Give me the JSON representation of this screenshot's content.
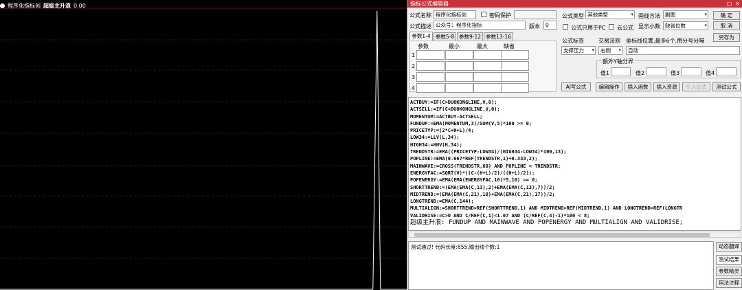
{
  "chart": {
    "indicator_name": "程序化指标创",
    "signal_label": "超级主升浪",
    "signal_value": "0.00",
    "colors": {
      "background": "#000000",
      "line": "#ffffff",
      "grid": "#6b0f12"
    },
    "spike": {
      "baseline": 0.0,
      "peak": 1.0,
      "position": 0.927
    }
  },
  "editor": {
    "title": "指标公式编辑器",
    "name_label": "公式名称",
    "name_value": "程序化指标创",
    "password_label": "密码保护",
    "desc_label": "公式描述",
    "desc_value": "公众号：程序化指标",
    "version_label": "版本",
    "version_value": "0",
    "type_label": "公式类型",
    "type_value": "其他类型",
    "draw_label": "画线方法",
    "draw_value": "副图",
    "confirm_button": "确 定",
    "cancel_button": "取 消",
    "saveas_button": "另存为",
    "pc_only_label": "公式只用于PC",
    "cloud_label": "云公式",
    "decimals_label": "显示小数",
    "decimals_value": "缺省位数",
    "tabs": [
      "参数1-4",
      "参数5-8",
      "参数9-12",
      "参数13-16"
    ],
    "param_headers": [
      "参数",
      "最小",
      "最大",
      "缺省"
    ],
    "param_rows": [
      "1",
      "2",
      "3",
      "4"
    ],
    "tag_label": "公式标签",
    "tag_value": "支撑压力",
    "trade_label": "交易法则",
    "trade_value": "右侧",
    "axis_label": "坐标线位置,最多6个,用分号分隔",
    "axis_value": "自动",
    "extra_axis_label": "额外Y轴分界",
    "extra_values": [
      "值1",
      "值2",
      "值3",
      "值4"
    ],
    "toolbar": [
      "AI写公式",
      "编辑操作",
      "插入函数",
      "插入资源",
      "引入公式",
      "测试公式"
    ],
    "code_lines": [
      "ACTBUY:=IF(C>DUOKONGLINE,V,0);",
      "ACTSELL:=IF(C<DUOKONGLINE,V,0);",
      "MOMENTUM:=ACTBUY-ACTSELL;",
      "FUNDUP:=EMA(MOMENTUM,3)/SUM(V,5)*100 >= 0;",
      "PRICETYP:=(2*C+H+L)/4;",
      "LOW34:=LLV(L,34);",
      "HIGH34:=HHV(H,34);",
      "TRENDSTR:=EMA((PRICETYP-LOW34)/(HIGH34-LOW34)*100,13);",
      "POPLINE:=EMA(0.667*REF(TRENDSTR,1)+0.333,2);",
      "MAINWAVE:=CROSS(TRENDSTR,60) AND POPLINE < TRENDSTR;",
      "ENERGYFAC:=SQRT(V)*((C-(H+L)/2)/((H+L)/2));",
      "POPENERGY:=EMA(EMA(ENERGYFAC,10)*5,10) >= 0;",
      "SHORTTREND:=(EMA(EMA(C,13),2)+EMA(EMA(C,13),7))/2;",
      "MIDTREND:=(EMA(EMA(C,21),10)+EMA(EMA(C,21),17))/2;",
      "LONGTREND:=EMA(C,144);",
      "MULTIALIGN:=SHORTTREND>REF(SHORTTREND,1) AND MIDTREND>REF(MIDTREND,1) AND LONGTREND>REF(LONGTR",
      "VALIDRISE:=C>O AND C/REF(C,1)<1.07 AND (C/REF(C,4)-1)*100 < 8;",
      "超级主升浪: FUNDUP AND MAINWAVE AND POPENERGY AND MULTIALIGN AND VALIDRISE;"
    ],
    "status_text": "测试通过! 代码长度:855,输出线个数:1",
    "side_buttons": [
      "动态翻译",
      "测试结果",
      "参数精灵",
      "用法注释"
    ]
  }
}
